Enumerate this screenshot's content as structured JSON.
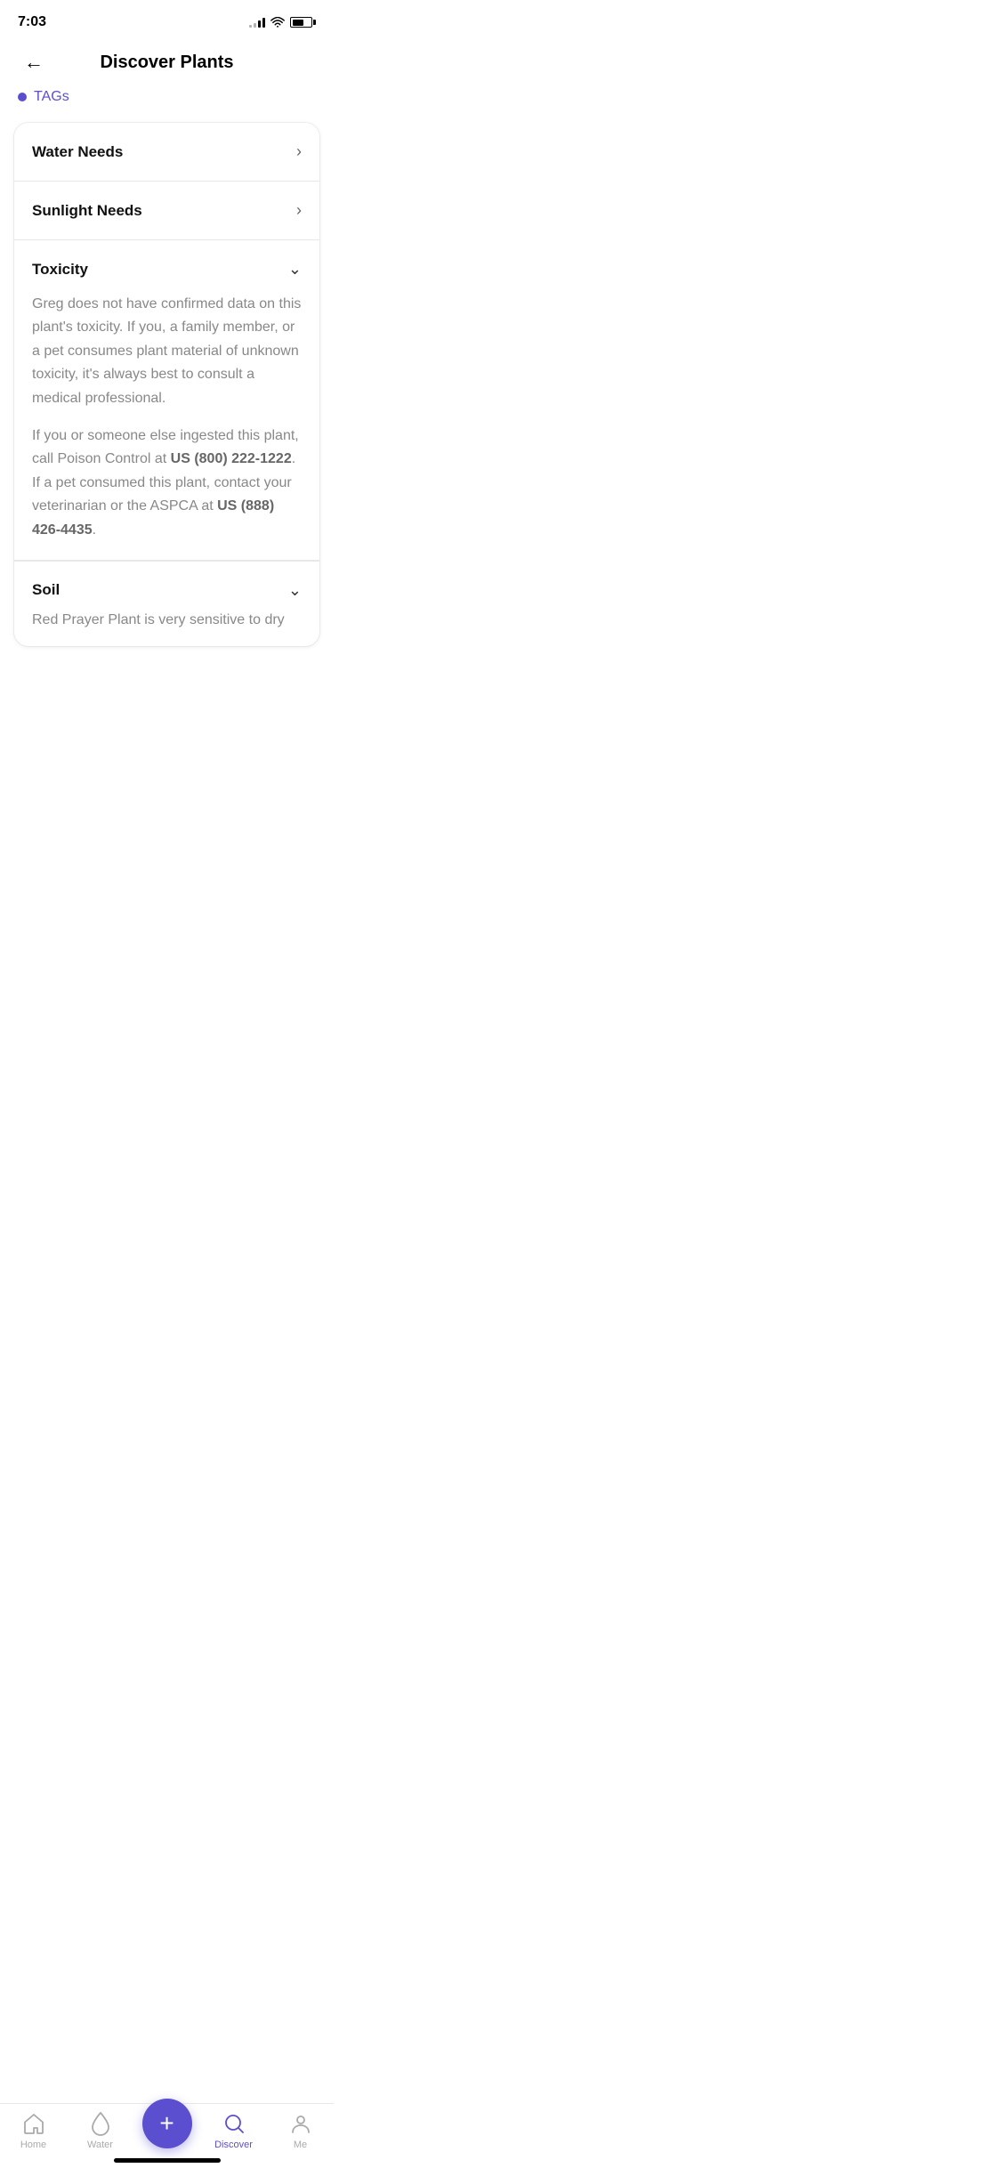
{
  "status": {
    "time": "7:03"
  },
  "header": {
    "title": "Discover Plants",
    "back_label": "←"
  },
  "tags_row": {
    "label": "TAGs"
  },
  "accordion": {
    "water_needs_label": "Water Needs",
    "sunlight_needs_label": "Sunlight Needs",
    "toxicity_label": "Toxicity",
    "toxicity_text1": "Greg does not have confirmed data on this plant's toxicity. If you, a family member, or a pet consumes plant material of unknown toxicity, it's always best to consult a medical professional.",
    "toxicity_text2_before": "If you or someone else ingested this plant, call Poison Control at ",
    "toxicity_phone1": "US (800) 222-1222",
    "toxicity_text2_after": ". If a pet consumed this plant, contact your veterinarian or the ASPCA at ",
    "toxicity_phone2": "US (888) 426-4435",
    "toxicity_text2_end": ".",
    "soil_label": "Soil",
    "soil_text": "Red Prayer Plant is very sensitive to dry"
  },
  "bottom_nav": {
    "home_label": "Home",
    "water_label": "Water",
    "discover_label": "Discover",
    "me_label": "Me"
  }
}
